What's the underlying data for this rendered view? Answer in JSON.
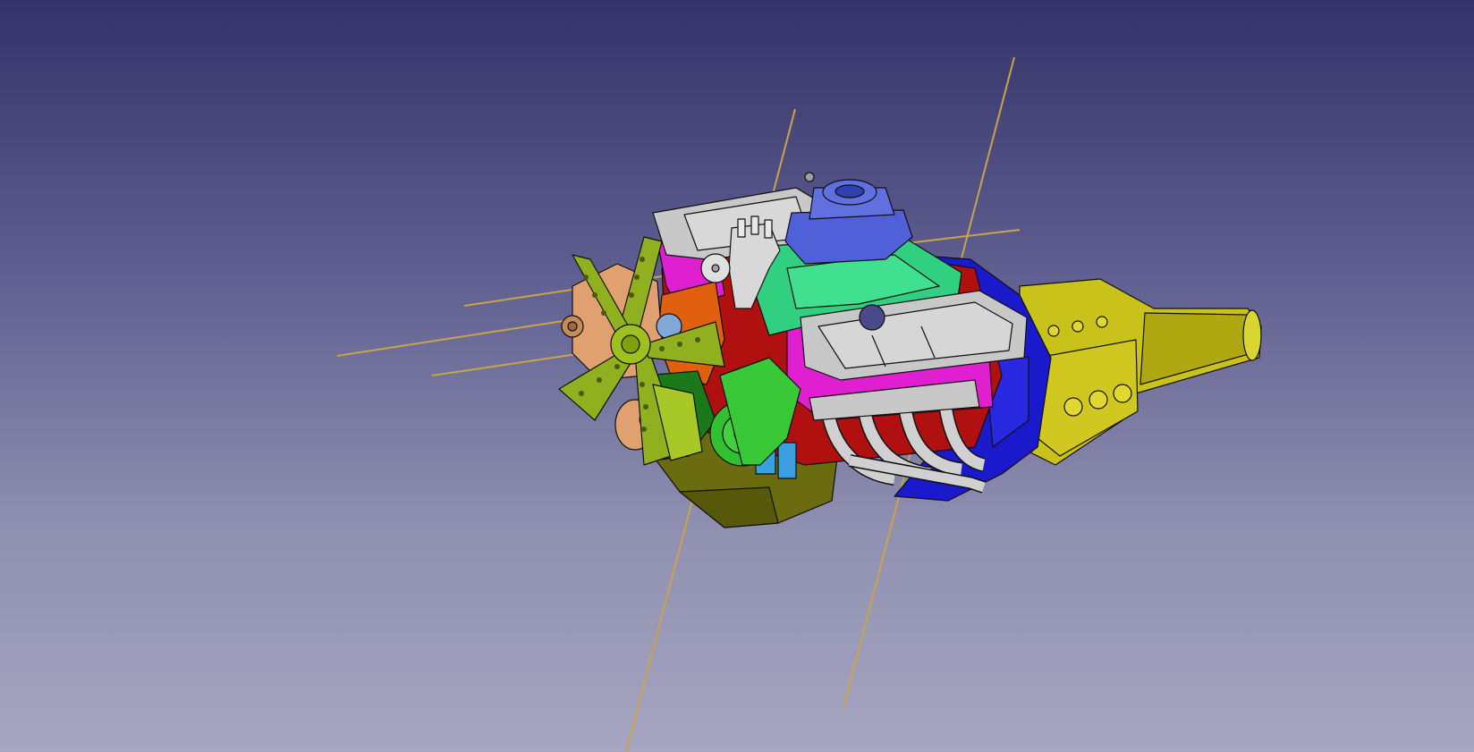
{
  "viewport": {
    "kind": "3d-cad-view",
    "background": {
      "top": "#33336a",
      "bottom": "#a6a6c2"
    },
    "axis_line_color": "#c8a44a"
  },
  "model": {
    "parts": [
      {
        "name": "transmission",
        "color": "#c8c21a"
      },
      {
        "name": "bellhousing",
        "color": "#1a1acc"
      },
      {
        "name": "oil-pan",
        "color": "#6b6b10"
      },
      {
        "name": "engine-block",
        "color": "#b01010"
      },
      {
        "name": "timing-cover",
        "color": "#e06010"
      },
      {
        "name": "intake-manifold",
        "color": "#30d080"
      },
      {
        "name": "carburetor",
        "color": "#5060d8"
      },
      {
        "name": "valve-cover-left",
        "color": "#c8c8c8"
      },
      {
        "name": "valve-cover-right",
        "color": "#c8c8c8"
      },
      {
        "name": "exhaust-header",
        "color": "#d0d0d0"
      },
      {
        "name": "cylinder-head",
        "color": "#e020d0"
      },
      {
        "name": "distributor",
        "color": "#d8d8d8"
      },
      {
        "name": "water-pump",
        "color": "#30c030"
      },
      {
        "name": "fan",
        "color": "#90b020"
      },
      {
        "name": "pulley",
        "color": "#e0a070"
      },
      {
        "name": "alternator-bracket",
        "color": "#80a8d8"
      }
    ]
  }
}
